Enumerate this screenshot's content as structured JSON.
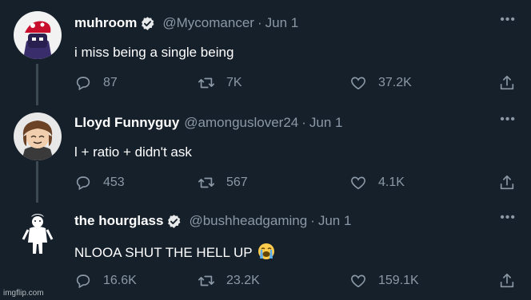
{
  "tweets": [
    {
      "name": "muhroom",
      "verified": true,
      "handle": "@Mycomancer",
      "separator": "·",
      "date": "Jun 1",
      "text": "i miss being a single being",
      "replies": "87",
      "retweets": "7K",
      "likes": "37.2K"
    },
    {
      "name": "Lloyd Funnyguy",
      "verified": false,
      "handle": "@amonguslover24",
      "separator": "·",
      "date": "Jun 1",
      "text": "l + ratio + didn't ask",
      "replies": "453",
      "retweets": "567",
      "likes": "4.1K"
    },
    {
      "name": "the hourglass",
      "verified": true,
      "handle": "@bushheadgaming",
      "separator": "·",
      "date": "Jun 1",
      "text": "NLOOA SHUT THE HELL UP",
      "emoji": "loudly-crying-face",
      "replies": "16.6K",
      "retweets": "23.2K",
      "likes": "159.1K"
    }
  ],
  "icons": {
    "more": "more-icon",
    "reply": "reply-icon",
    "retweet": "retweet-icon",
    "like": "heart-icon",
    "share": "share-icon",
    "verified": "verified-badge-icon"
  },
  "colors": {
    "background": "#15202b",
    "muted": "#8b98a5",
    "thread_line": "#3c4852"
  },
  "watermark": "imgflip.com"
}
